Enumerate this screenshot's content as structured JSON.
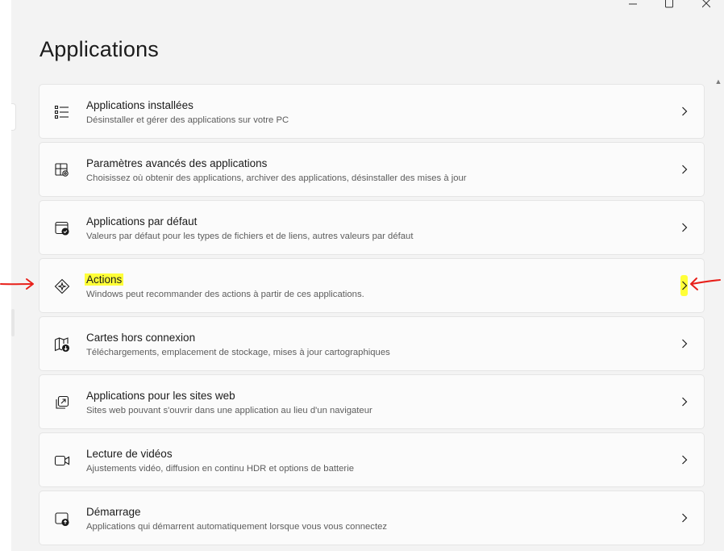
{
  "window": {
    "title": "Applications",
    "controls": [
      "minimize",
      "maximize",
      "close"
    ]
  },
  "items": [
    {
      "title": "Applications installées",
      "subtitle": "Désinstaller et gérer des applications sur votre PC",
      "icon": "list-icon"
    },
    {
      "title": "Paramètres avancés des applications",
      "subtitle": "Choisissez où obtenir des applications, archiver des applications, désinstaller des mises à jour",
      "icon": "apps-gear-icon"
    },
    {
      "title": "Applications par défaut",
      "subtitle": "Valeurs par défaut pour les types de fichiers et de liens, autres valeurs par défaut",
      "icon": "default-apps-icon"
    },
    {
      "title": "Actions",
      "subtitle": "Windows peut recommander des actions à partir de ces applications.",
      "icon": "actions-icon"
    },
    {
      "title": "Cartes hors connexion",
      "subtitle": "Téléchargements, emplacement de stockage, mises à jour cartographiques",
      "icon": "offline-maps-icon"
    },
    {
      "title": "Applications pour les sites web",
      "subtitle": "Sites web pouvant s'ouvrir dans une application au lieu d'un navigateur",
      "icon": "website-apps-icon"
    },
    {
      "title": "Lecture de vidéos",
      "subtitle": "Ajustements vidéo, diffusion en continu HDR et options de batterie",
      "icon": "video-icon"
    },
    {
      "title": "Démarrage",
      "subtitle": "Applications qui démarrent automatiquement lorsque vous vous connectez",
      "icon": "startup-icon"
    }
  ],
  "colors": {
    "highlight": "#ffff38",
    "annotation_arrow": "#e8201a"
  }
}
